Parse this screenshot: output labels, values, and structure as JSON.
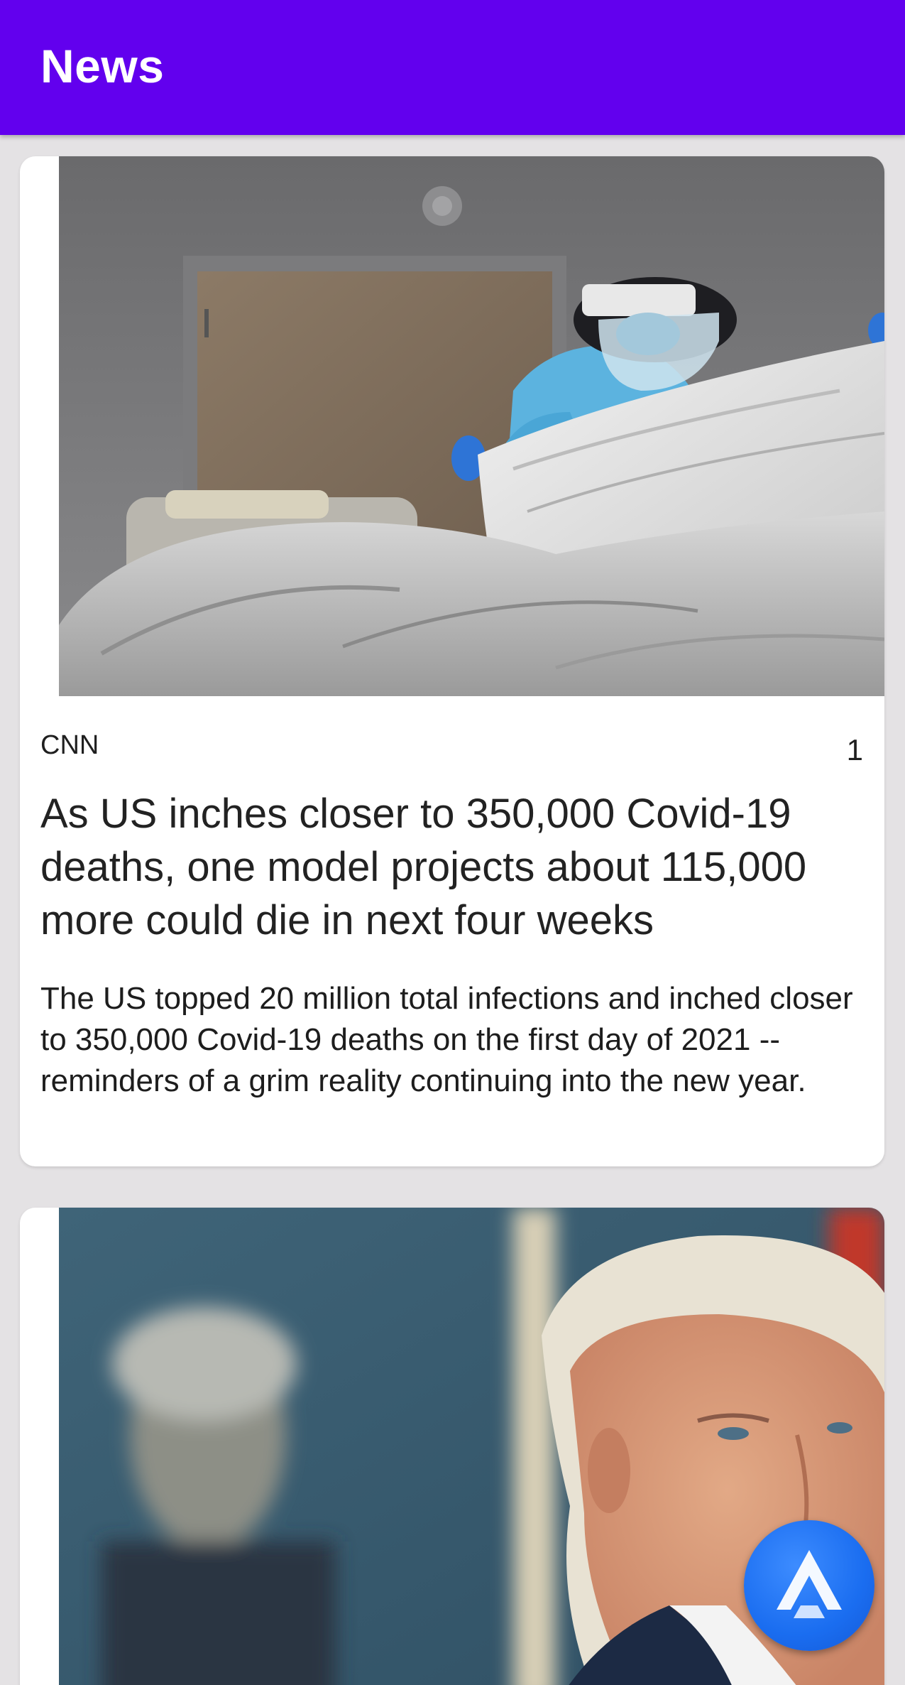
{
  "app_bar": {
    "title": "News"
  },
  "articles": [
    {
      "source": "CNN",
      "index": "1",
      "headline": "As US inches closer to 350,000 Covid-19 deaths, one model projects about 115,000 more could die in next four weeks",
      "summary": "The US topped 20 million total infections and inched closer to 350,000 Covid-19 deaths on the first day of 2021 -- reminders of a grim reality continuing into the new year.",
      "image": "hospital-worker-photo"
    },
    {
      "image": "president-portrait-photo"
    }
  ],
  "fab": {
    "icon": "assistant-triangle-icon"
  },
  "colors": {
    "app_bar": "#6200ee",
    "background": "#e4e2e4",
    "card": "#ffffff",
    "fab": "#1a6df0"
  }
}
